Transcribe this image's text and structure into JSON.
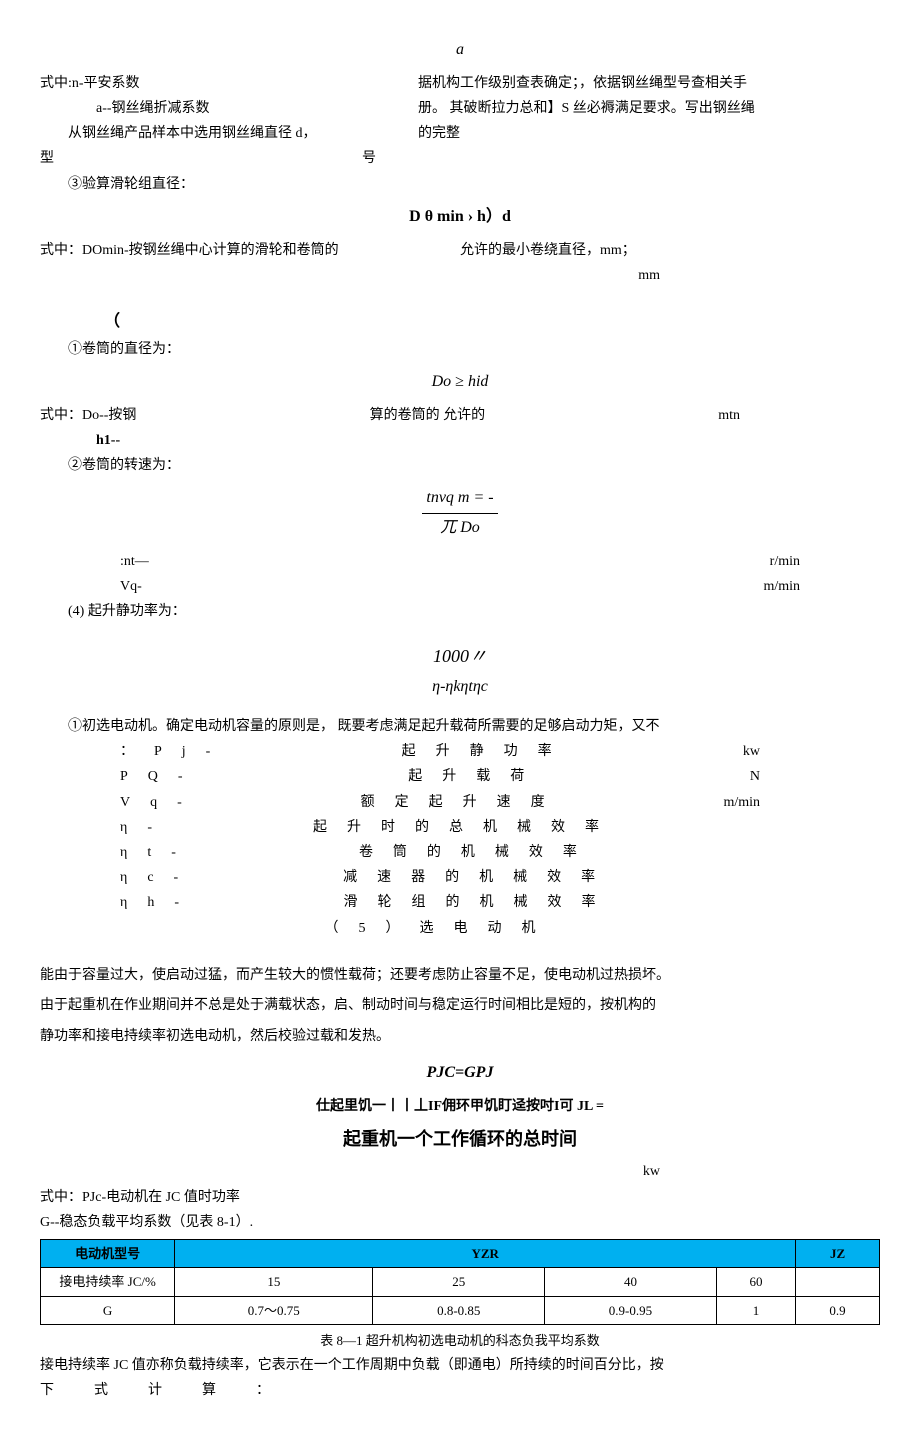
{
  "top": {
    "a_var": "a",
    "left1": "式中:n-平安系数",
    "left2": "a--钢丝绳折减系数",
    "left3": "从钢丝绳产品样本中选用钢丝绳直径 d，",
    "right1": "据机构工作级别查表确定；，依据钢丝绳型号查相关手",
    "right2": "册。  其破断拉力总和】S 丝必褥满足要求。写出钢丝绳",
    "right3": "的完整",
    "model_l": "型",
    "model_r": "号"
  },
  "sec3": {
    "title": "③验算滑轮组直径：",
    "formula": "D θ min › h）d",
    "left": "式中：DOmin-按钢丝绳中心计算的滑轮和卷筒的",
    "right": "允许的最小卷绕直径，mm；",
    "unit": "mm"
  },
  "paren": "（",
  "sub1": {
    "title": "①卷筒的直径为：",
    "formula": "Do  ≥  hid",
    "left": "式中：Do--按钢",
    "mid": "算的卷筒的  允许的",
    "unit": "mtn",
    "h1": "h1--"
  },
  "sub2": {
    "title": "②卷筒的转速为：",
    "formula_top": "tnvq m = -",
    "formula_bot": "兀 Do",
    "nt": ":nt—",
    "nt_unit": "r/min",
    "vq": "Vq-",
    "vq_unit": "m/min"
  },
  "sec4": {
    "title": "(4)    起升静功率为：",
    "formula_top": "1000〃",
    "formula_bot": "η-ηkηtηc"
  },
  "motor_intro": "①初选电动机。确定电动机容量的原则是，  既要考虑满足起升载荷所需要的足够启动力矩，又不",
  "defs": [
    {
      "sym": "：Pj-",
      "txt": "起升静功率",
      "unit": "kw"
    },
    {
      "sym": "PQ-",
      "txt": "起升载荷",
      "unit": "N"
    },
    {
      "sym": "Vq-",
      "txt": "额定起升速度",
      "unit": "m/min"
    },
    {
      "sym": "η-",
      "txt": "起升时的总机械效率",
      "unit": ""
    },
    {
      "sym": "ηt-",
      "txt": "卷筒的机械效率",
      "unit": ""
    },
    {
      "sym": "ηc-",
      "txt": "减速器的机械效率",
      "unit": ""
    },
    {
      "sym": "ηh-",
      "txt": "滑轮组的机械效率",
      "unit": ""
    }
  ],
  "sec5": "（5）选电动机",
  "para1": "能由于容量过大，使启动过猛，而产生较大的惯性载荷；还要考虑防止容量不足，使电动机过热损坏。",
  "para2": "由于起重机在作业期间并不总是处于满载状态，启、制动时间与稳定运行时间相比是短的，按机构的",
  "para3": "静功率和接电持续率初选电动机，然后校验过载和发热。",
  "pjc_formula": "PJC=GPJ",
  "cycle_strike": "仕起里饥一丨丨丄IF佣环甲饥盯迳按吋I可 JL =",
  "cycle_title": "起重机一个工作循环的总时间",
  "kw": "kw",
  "pjc_def": "式中：PJc-电动机在 JC 值时功率",
  "g_def": "G--稳态负载平均系数（见表 8-1）.",
  "table": {
    "h1": "电动机型号",
    "h2": "YZR",
    "h3": "JZ",
    "r1_label": "接电持续率 JC/%",
    "r1": [
      "15",
      "25",
      "40",
      "60",
      ""
    ],
    "r2_label": "G",
    "r2": [
      "0.7～0.75",
      "0.8-0.85",
      "0.9-0.95",
      "1",
      "0.9"
    ]
  },
  "table_caption": "表 8—1 超升机构初选电动机的科态负我平均系数",
  "jc_para": "接电持续率 JC 值亦称负载持续率，它表示在一个工作周期中负载（即通电）所持续的时间百分比，按",
  "jc_end": "下式计算：",
  "chart_data": {
    "type": "table",
    "title": "表 8—1 超升机构初选电动机的科态负我平均系数",
    "columns": [
      "电动机型号",
      "YZR(15)",
      "YZR(25)",
      "YZR(40)",
      "YZR(60)",
      "JZ"
    ],
    "rows": [
      {
        "label": "接电持续率 JC/%",
        "values": [
          15,
          25,
          40,
          60,
          null
        ]
      },
      {
        "label": "G",
        "values": [
          "0.7～0.75",
          "0.8-0.85",
          "0.9-0.95",
          1,
          0.9
        ]
      }
    ]
  }
}
